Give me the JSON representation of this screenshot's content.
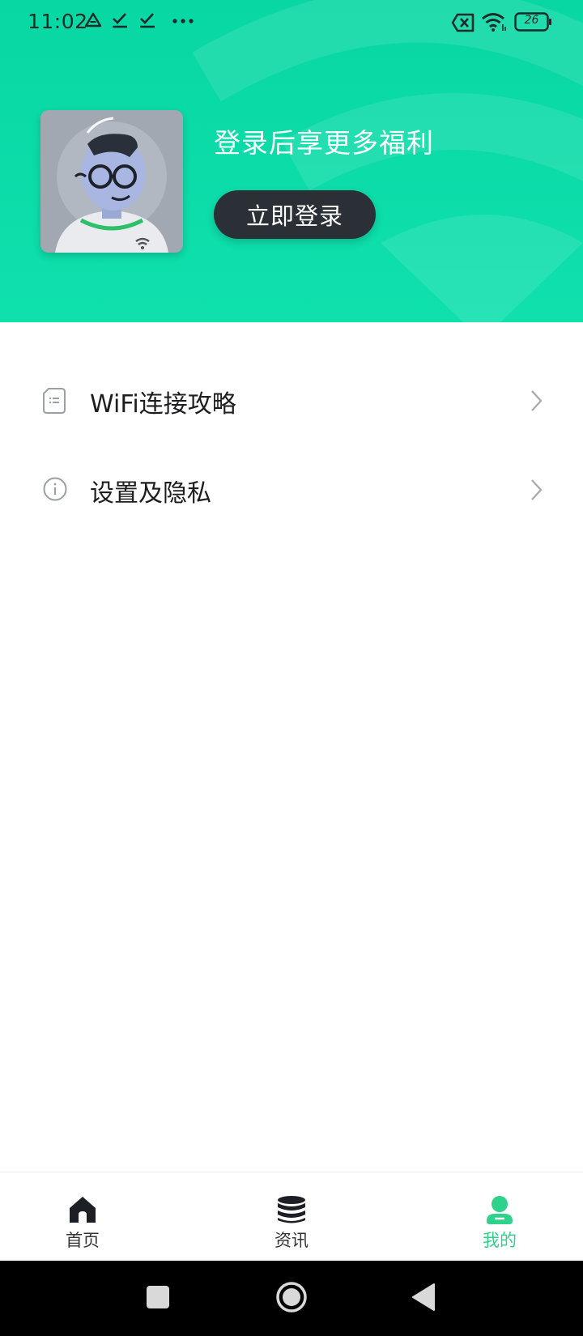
{
  "status_bar": {
    "time": "11:02",
    "battery": "26",
    "icons": [
      "drive-icon",
      "check-icon",
      "check-icon",
      "more-dots-icon",
      "no-sim-icon",
      "wifi-signal-icon",
      "battery-icon"
    ]
  },
  "header": {
    "title": "登录后享更多福利",
    "login_button": "立即登录",
    "colors": {
      "accent": "#08d7a3",
      "button": "#2b3036"
    }
  },
  "menu": {
    "items": [
      {
        "label": "WiFi连接攻略",
        "icon": "document-icon"
      },
      {
        "label": "设置及隐私",
        "icon": "info-icon"
      }
    ]
  },
  "bottom_nav": {
    "items": [
      {
        "label": "首页",
        "icon": "home-icon",
        "active": false
      },
      {
        "label": "资讯",
        "icon": "database-icon",
        "active": false
      },
      {
        "label": "我的",
        "icon": "profile-icon",
        "active": true
      }
    ],
    "active_color": "#2fd28a"
  }
}
